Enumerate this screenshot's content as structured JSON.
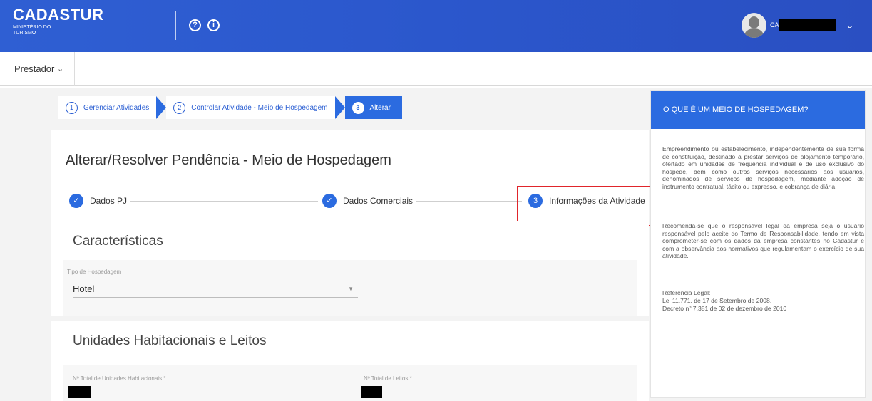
{
  "header": {
    "brand_title": "CADASTUR",
    "brand_subtitle": "MINISTÉRIO DO TURISMO",
    "help_icon_glyph": "?",
    "info_icon_glyph": "i",
    "user_name_prefix": "CA",
    "user_icon": "avatar-icon",
    "menu_icon": "chevron-down-icon",
    "bg_color": "#2b57cc"
  },
  "subbar": {
    "profile_label": "Prestador",
    "profile_chevron": "⌄"
  },
  "breadcrumb": {
    "items": [
      {
        "number": "1",
        "label": "Gerenciar Atividades"
      },
      {
        "number": "2",
        "label": "Controlar Atividade - Meio de Hospedagem"
      },
      {
        "number": "3",
        "label": "Alterar"
      }
    ],
    "active_color": "#2b6be0"
  },
  "page": {
    "title": "Alterar/Resolver Pendência - Meio de Hospedagem",
    "steps": [
      {
        "label": "Dados PJ",
        "state": "done",
        "icon": "check-icon"
      },
      {
        "label": "Dados Comerciais",
        "state": "done",
        "icon": "check-icon"
      },
      {
        "number": "3",
        "label": "Informações da Atividade",
        "state": "current"
      }
    ]
  },
  "caracteristicas": {
    "title": "Características",
    "tipo_label": "Tipo de Hospedagem",
    "tipo_value": "Hotel",
    "tipo_arrow": "▼"
  },
  "unidades": {
    "title": "Unidades Habitacionais e Leitos",
    "uh_label": "Nº Total de Unidades Habitacionais *",
    "leitos_label": "Nº Total de Leitos *"
  },
  "sidebar": {
    "heading": "O QUE É UM MEIO DE HOSPEDAGEM?",
    "paragraph1": "Empreendimento ou estabelecimento, independentemente de sua forma de constituição, destinado a prestar serviços de alojamento temporário, ofertado em unidades de frequência individual e de uso exclusivo do hóspede, bem como outros serviços necessários aos usuários, denominados de serviços de hospedagem, mediante adoção de instrumento contratual, tácito ou expresso, e cobrança de diária.",
    "paragraph2": "Recomenda-se que o responsável legal da empresa seja o usuário responsável pelo aceite do Termo de Responsabilidade, tendo em vista comprometer-se com os dados da empresa constantes no Cadastur e com a observância aos normativos que regulamentam o exercício de sua atividade.",
    "ref_title": "Referência Legal:",
    "ref_line1": "Lei 11.771, de 17 de Setembro de 2008.",
    "ref_line2": "Decreto nº 7.381 de 02 de dezembro de 2010"
  }
}
